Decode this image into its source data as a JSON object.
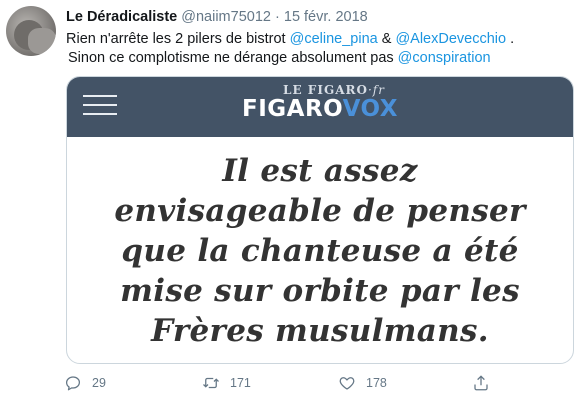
{
  "tweet": {
    "author_name": "Le Déradicaliste",
    "author_handle": "@naiim75012",
    "separator": "·",
    "date": "15 févr. 2018",
    "text_line1_a": "Rien n'arrête les 2 pilers de bistrot ",
    "mention1": "@celine_pina",
    "text_line1_b": " & ",
    "mention2": "@AlexDevecchio",
    "text_line1_c": " .",
    "text_line2_a": "Sinon ce complotisme ne dérange absolument pas ",
    "mention3": "@conspiration"
  },
  "card": {
    "logo_small_main": "LE FIGARO",
    "logo_small_suffix": "·fr",
    "logo_figaro": "FIGARO",
    "logo_vox": "VOX",
    "quote_lines": [
      "Il est assez",
      "envisageable de penser",
      "que la chanteuse a été",
      "mise sur orbite par les",
      "Frères musulmans."
    ],
    "header_color": "#435366",
    "vox_color": "#4a90d9"
  },
  "actions": {
    "reply_icon": "reply-icon",
    "reply_count": "29",
    "retweet_icon": "retweet-icon",
    "retweet_count": "171",
    "like_icon": "heart-icon",
    "like_count": "178",
    "share_icon": "share-icon"
  },
  "colors": {
    "mention": "#1b95e0",
    "secondary_text": "#657786"
  }
}
